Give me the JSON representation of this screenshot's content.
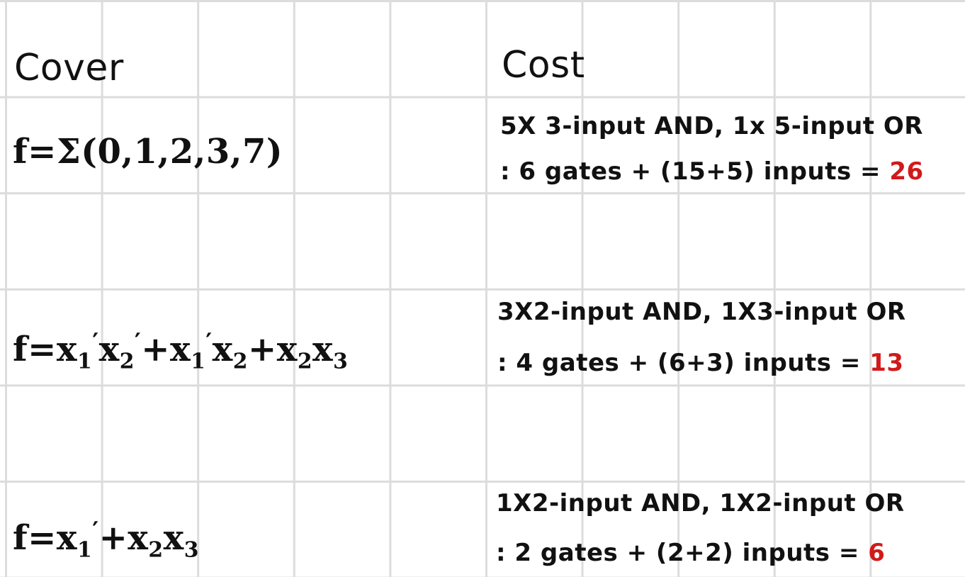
{
  "headers": {
    "cover": "Cover",
    "cost": "Cost"
  },
  "rows": [
    {
      "formula": "f=Σ(0,1,2,3,7)",
      "cost_line1": "5X 3-input AND, 1x 5-input OR",
      "cost_line2_prefix": ": 6 gates + (15+5) inputs =",
      "total": "26"
    },
    {
      "formula_parts": {
        "f": "f",
        "eq": "=",
        "x": "x",
        "one": "1",
        "two": "2",
        "three": "3",
        "prime": "′",
        "plus": "+"
      },
      "cost_line1": "3X2-input AND, 1X3-input OR",
      "cost_line2_prefix": ": 4 gates + (6+3) inputs =",
      "total": "13"
    },
    {
      "cost_line1": "1X2-input AND, 1X2-input OR",
      "cost_line2_prefix": ": 2 gates + (2+2) inputs =",
      "total": "6"
    }
  ],
  "colors": {
    "grid": "#dcdcdc",
    "ink": "#111111",
    "total": "#d11a1a"
  }
}
